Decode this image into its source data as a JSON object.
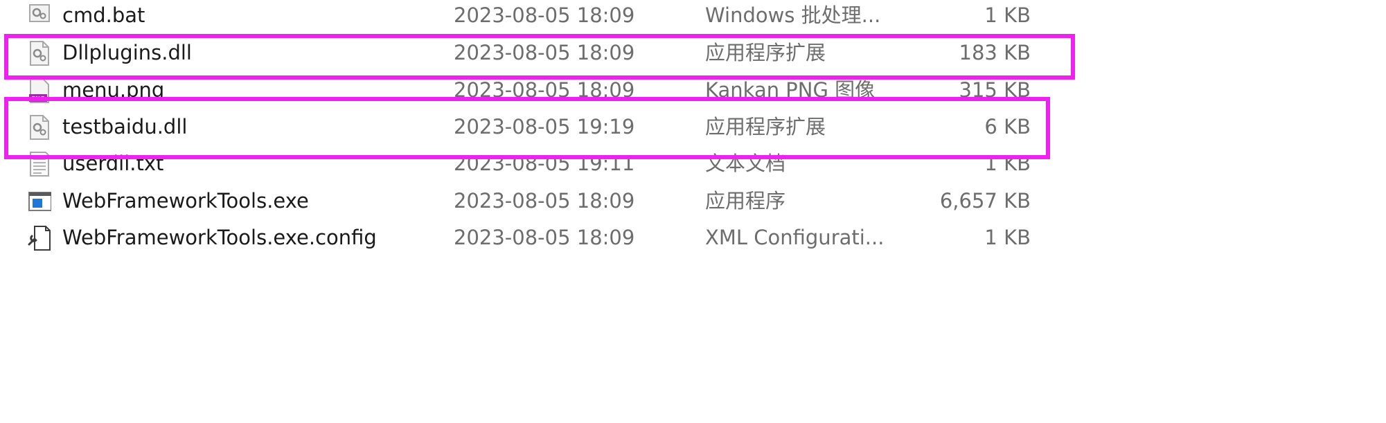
{
  "files": [
    {
      "name": "cmd.bat",
      "date": "2023-08-05 18:09",
      "type": "Windows 批处理...",
      "size": "1 KB",
      "icon": "batch-file-icon"
    },
    {
      "name": "Dllplugins.dll",
      "date": "2023-08-05 18:09",
      "type": "应用程序扩展",
      "size": "183 KB",
      "icon": "dll-file-icon"
    },
    {
      "name": "menu.png",
      "date": "2023-08-05 18:09",
      "type": "Kankan PNG 图像",
      "size": "315 KB",
      "icon": "png-file-icon"
    },
    {
      "name": "testbaidu.dll",
      "date": "2023-08-05 19:19",
      "type": "应用程序扩展",
      "size": "6 KB",
      "icon": "dll-file-icon"
    },
    {
      "name": "userdll.txt",
      "date": "2023-08-05 19:11",
      "type": "文本文档",
      "size": "1 KB",
      "icon": "text-file-icon"
    },
    {
      "name": "WebFrameworkTools.exe",
      "date": "2023-08-05 18:09",
      "type": "应用程序",
      "size": "6,657 KB",
      "icon": "exe-file-icon"
    },
    {
      "name": "WebFrameworkTools.exe.config",
      "date": "2023-08-05 18:09",
      "type": "XML Configurati...",
      "size": "1 KB",
      "icon": "config-file-icon"
    }
  ],
  "colors": {
    "highlight": "#ee22ee",
    "name_text": "#1a1a1a",
    "meta_text": "#6d6d6d"
  }
}
